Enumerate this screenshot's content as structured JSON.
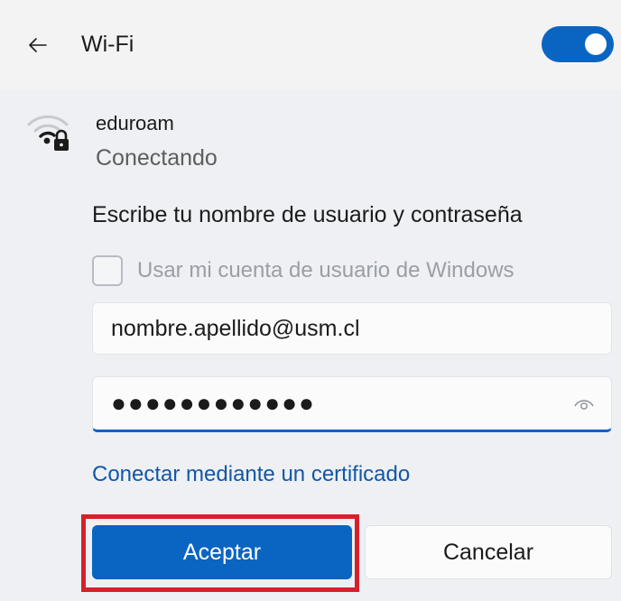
{
  "header": {
    "back_icon": "arrow-left-icon",
    "title": "Wi-Fi",
    "toggle_state": "on",
    "accent_color": "#0a64c2"
  },
  "network": {
    "icon": "wifi-secured-icon",
    "name": "eduroam",
    "status": "Conectando",
    "prompt": "Escribe tu nombre de usuario y contraseña",
    "use_windows_account_label": "Usar mi cuenta de usuario de Windows",
    "use_windows_account_checked": false,
    "username_value": "nombre.apellido@usm.cl",
    "password_value": "●●●●●●●●●●●●",
    "reveal_icon": "eye-icon",
    "certificate_link": "Conectar mediante un certificado",
    "accept_label": "Aceptar",
    "cancel_label": "Cancelar",
    "highlight_color": "#d8202a"
  }
}
